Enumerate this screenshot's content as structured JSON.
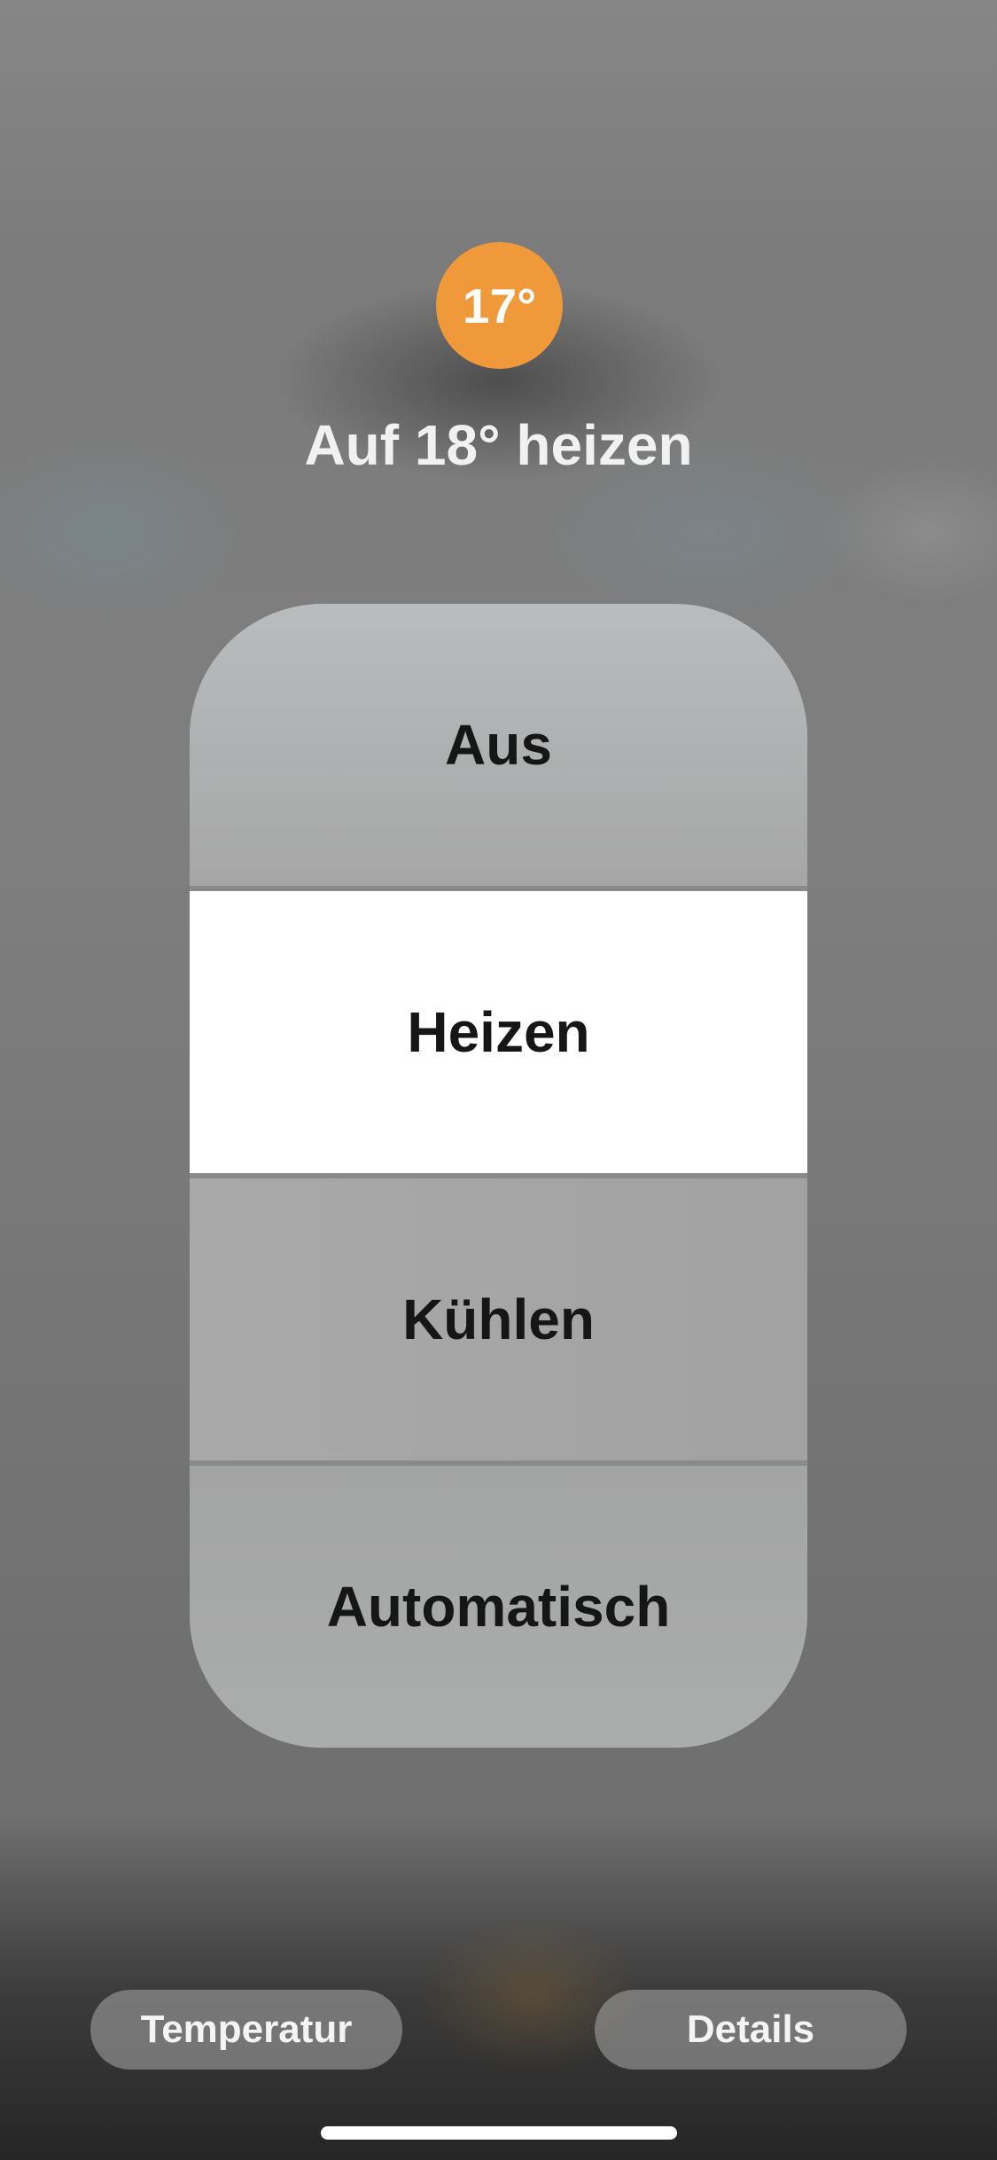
{
  "thermostat": {
    "current_temperature": "17°",
    "status": "Auf 18° heizen",
    "accent_color": "#f0993a"
  },
  "mode_picker": {
    "options": [
      {
        "label": "Aus",
        "selected": false
      },
      {
        "label": "Heizen",
        "selected": true
      },
      {
        "label": "Kühlen",
        "selected": false
      },
      {
        "label": "Automatisch",
        "selected": false
      }
    ]
  },
  "footer": {
    "temperature_label": "Temperatur",
    "details_label": "Details"
  }
}
